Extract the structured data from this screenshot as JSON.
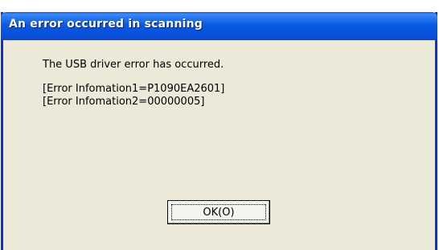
{
  "window": {
    "title": "An error occurred in scanning"
  },
  "message": {
    "text": "The USB driver error has occurred.",
    "error_info_1": "[Error Infomation1=P1090EA2601]",
    "error_info_2": "[Error Infomation2=00000005]"
  },
  "buttons": {
    "ok_label": "OK(O)"
  },
  "colors": {
    "titlebar": "#0552dc",
    "dialog_background": "#ece9d8",
    "frame_border": "#0831d9"
  }
}
